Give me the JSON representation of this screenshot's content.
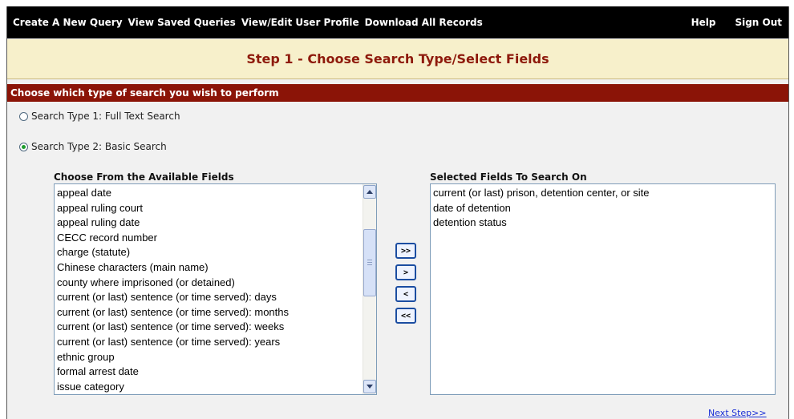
{
  "nav": {
    "links": [
      "Create A New Query",
      "View Saved Queries",
      "View/Edit User Profile",
      "Download All Records"
    ],
    "help": "Help",
    "signout": "Sign Out"
  },
  "step_title": "Step 1 - Choose Search Type/Select Fields",
  "section_title": "Choose which type of search you wish to perform",
  "search_types": {
    "full_text": "Search Type 1: Full Text Search",
    "basic": "Search Type 2: Basic Search",
    "selected": "basic"
  },
  "available": {
    "heading": "Choose From the Available Fields",
    "items": [
      "appeal date",
      "appeal ruling court",
      "appeal ruling date",
      "CECC record number",
      "charge (statute)",
      "Chinese characters (main name)",
      "county where imprisoned (or detained)",
      "current (or last) sentence (or time served): days",
      "current (or last) sentence (or time served): months",
      "current (or last) sentence (or time served): weeks",
      "current (or last) sentence (or time served): years",
      "ethnic group",
      "formal arrest date",
      "issue category"
    ]
  },
  "selected_fields": {
    "heading": "Selected Fields To Search On",
    "items": [
      "current (or last) prison, detention center, or site",
      "date of detention",
      "detention status"
    ]
  },
  "buttons": {
    "add_all": ">>",
    "add": ">",
    "remove": "<",
    "remove_all": "<<"
  },
  "next_step": "Next Step>>"
}
